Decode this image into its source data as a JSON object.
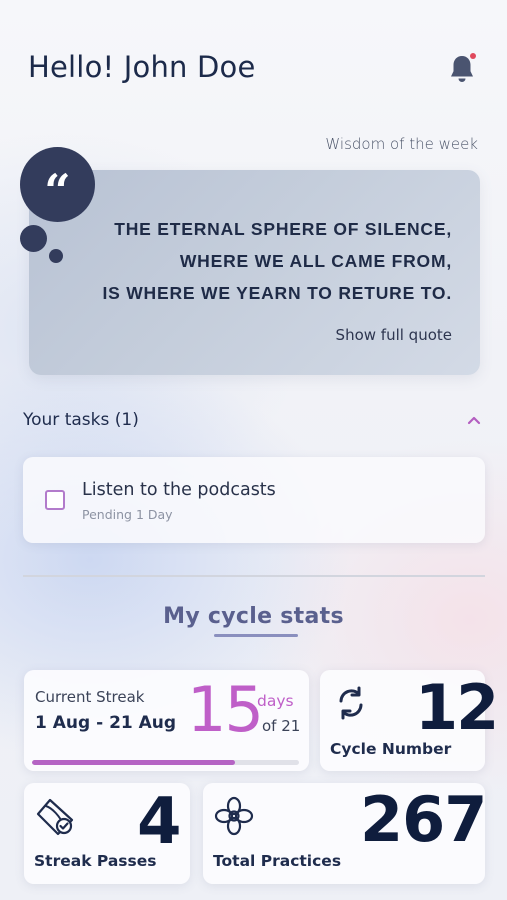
{
  "header": {
    "greeting": "Hello! John Doe",
    "notification_icon": "bell-icon",
    "has_unread_notifications": true
  },
  "wisdom": {
    "label": "Wisdom of the week",
    "quote_lines": [
      "THE ETERNAL SPHERE OF SILENCE,",
      "WHERE WE ALL CAME FROM,",
      "IS WHERE WE YEARN TO RETURE TO."
    ],
    "quote_mark": "“",
    "show_full_label": "Show full quote"
  },
  "tasks": {
    "title": "Your tasks (1)",
    "collapse_icon": "chevron-up-icon",
    "items": [
      {
        "label": "Listen to the podcasts",
        "status": "Pending 1 Day",
        "checked": false
      }
    ]
  },
  "stats": {
    "title": "My cycle stats",
    "streak": {
      "label": "Current Streak",
      "range": "1 Aug - 21 Aug",
      "value": "15",
      "unit": "days",
      "of_total": "of 21",
      "progress_fraction": 0.76
    },
    "cycle": {
      "value": "12",
      "label": "Cycle Number",
      "icon": "refresh-icon"
    },
    "passes": {
      "value": "4",
      "label": "Streak Passes",
      "icon": "badge-check-icon"
    },
    "practices": {
      "value": "267",
      "label": "Total Practices",
      "icon": "flower-icon"
    }
  },
  "colors": {
    "accent_purple": "#bf5fc8",
    "navy": "#333c5c",
    "notification_dot": "#e0495d"
  }
}
